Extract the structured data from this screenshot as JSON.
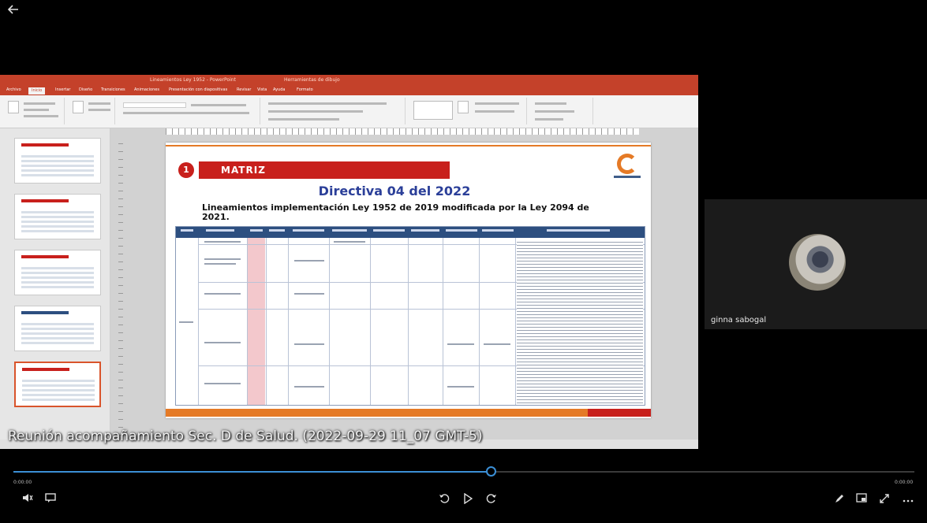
{
  "app": {
    "back_icon": "back-arrow-icon"
  },
  "share": {
    "ppt_title": "Lineamientos Ley 1952 - PowerPoint",
    "ppt_title_right": "Herramientas de dibujo",
    "tabs": [
      "Archivo",
      "Inicio",
      "Insertar",
      "Diseño",
      "Transiciones",
      "Animaciones",
      "Presentación con diapositivas",
      "Revisar",
      "Vista",
      "Ayuda",
      "Formato"
    ],
    "slide": {
      "number_badge": "1",
      "section_title": "MATRIZ",
      "title": "Directiva 04 del 2022",
      "subtitle": "Lineamientos implementación Ley 1952 de 2019 modificada por la Ley 2094 de 2021."
    }
  },
  "caption": "Reunión acompañamiento Sec. D de Salud.  (2022-09-29 11_07 GMT-5)",
  "participant": {
    "name": "ginna sabogal"
  },
  "player": {
    "progress": 0.53,
    "time_elapsed": "0:00:00",
    "time_total": "0:00:00",
    "icons": {
      "volume": "volume-icon",
      "captions": "captions-icon",
      "rewind": "rewind-10-icon",
      "play": "play-icon",
      "forward": "forward-30-icon",
      "pen": "pen-icon",
      "pip": "picture-in-picture-icon",
      "fullscreen": "fullscreen-icon",
      "more": "more-icon"
    }
  }
}
